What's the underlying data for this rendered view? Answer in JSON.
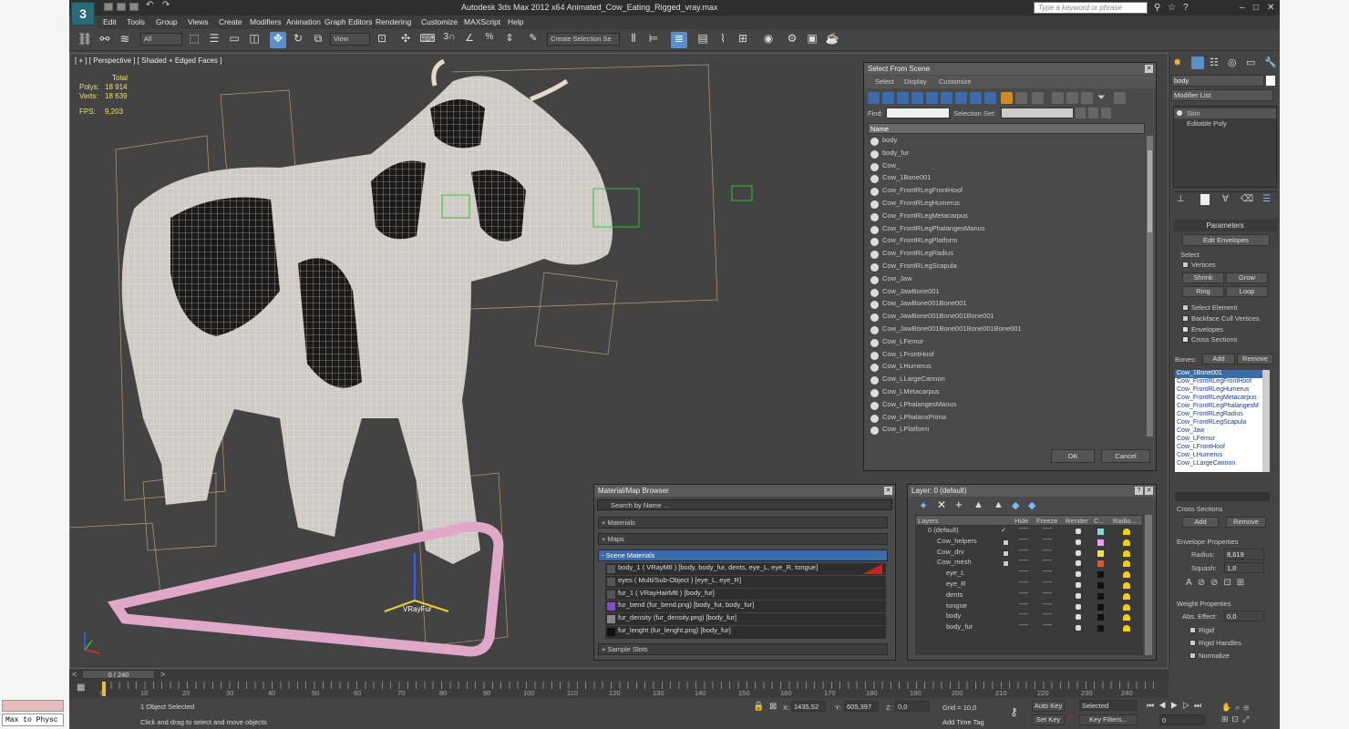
{
  "app": {
    "title": "Autodesk 3ds Max  2012 x64     Animated_Cow_Eating_Rigged_vray.max",
    "search_placeholder": "Type a keyword or phrase",
    "logo_text": "3"
  },
  "menu": [
    "Edit",
    "Tools",
    "Group",
    "Views",
    "Create",
    "Modifiers",
    "Animation",
    "Graph Editors",
    "Rendering",
    "Customize",
    "MAXScript",
    "Help"
  ],
  "toolbar": {
    "filter_value": "All",
    "view_value": "View",
    "selection_set_placeholder": "Create Selection Se"
  },
  "viewport": {
    "label": "[ + ] [ Perspective ] [ Shaded + Edged Faces ]",
    "stats": {
      "total_label": "Total",
      "polys_label": "Polys:",
      "polys_value": "18 914",
      "verts_label": "Verts:",
      "verts_value": "18 639",
      "fps_label": "FPS:",
      "fps_value": "9,203"
    },
    "gizmo_label": "VRayFur"
  },
  "select_from_scene": {
    "title": "Select From Scene",
    "menu": [
      "Select",
      "Display",
      "Customize"
    ],
    "find_label": "Find:",
    "selection_set_label": "Selection Set:",
    "column_name": "Name",
    "items": [
      "body",
      "body_fur",
      "Cow_",
      "Cow_1Bone001",
      "Cow_FrontRLegFrontHoof",
      "Cow_FrontRLegHumerus",
      "Cow_FrontRLegMetacarpus",
      "Cow_FrontRLegPhalangesManus",
      "Cow_FrontRLegPlatform",
      "Cow_FrontRLegRadius",
      "Cow_FrontRLegScapula",
      "Cow_Jaw",
      "Cow_JawBone001",
      "Cow_JawBone001Bone001",
      "Cow_JawBone001Bone001Bone001",
      "Cow_JawBone001Bone001Bone001Bone001",
      "Cow_LFemur",
      "Cow_LFrontHoof",
      "Cow_LHumerus",
      "Cow_LLargeCannon",
      "Cow_LMetacarpus",
      "Cow_LPhalangesManus",
      "Cow_LPhalanxPrima",
      "Cow_LPlatform"
    ],
    "ok_label": "OK",
    "cancel_label": "Cancel"
  },
  "material_browser": {
    "title": "Material/Map Browser",
    "search_placeholder": "Search by Name ...",
    "groups": [
      "+ Materials",
      "+ Maps",
      "- Scene Materials"
    ],
    "materials": [
      "body_1  ( VRayMtl ) [body, body_fur, dents, eye_L, eye_R, tongue]",
      "eyes  ( Multi/Sub-Object ) [eye_L, eye_R]",
      "fur_1  ( VRayHairMtl ) [body_fur]",
      "fur_bend (fur_bend.png) [body_fur, body_fur]",
      "fur_density (fur_density.png) [body_fur]",
      "fur_lenght (fur_lenght.png) [body_fur]"
    ],
    "sample_slots": "+ Sample Slots"
  },
  "layer_manager": {
    "title": "Layer: 0 (default)",
    "columns": [
      "Layers",
      "Hide",
      "Freeze",
      "Render",
      "C...",
      "Radio..."
    ],
    "layers": [
      {
        "name": "0 (default)",
        "indent": 0
      },
      {
        "name": "Cow_helpers",
        "indent": 0
      },
      {
        "name": "Cow_drv",
        "indent": 0
      },
      {
        "name": "Cow_mesh",
        "indent": 0
      },
      {
        "name": "eye_L",
        "indent": 1
      },
      {
        "name": "eye_R",
        "indent": 1
      },
      {
        "name": "dents",
        "indent": 1
      },
      {
        "name": "tongue",
        "indent": 1
      },
      {
        "name": "body",
        "indent": 1
      },
      {
        "name": "body_fur",
        "indent": 1
      }
    ],
    "hide_dots": "----"
  },
  "command_panel": {
    "object_name": "body",
    "modifier_list": "Modifier List",
    "stack": [
      "Skin",
      "Editable Poly"
    ],
    "parameters_title": "Parameters",
    "edit_envelopes": "Edit Envelopes",
    "select_label": "Select",
    "vertices": "Vertices",
    "shrink": "Shrink",
    "grow": "Grow",
    "ring": "Ring",
    "loop": "Loop",
    "select_element": "Select Element",
    "backface": "Backface Cull Vertices",
    "envelopes": "Envelopes",
    "cross_sections": "Cross Sections",
    "bones_label": "Bones:",
    "add": "Add",
    "remove": "Remove",
    "bones": [
      "Cow_1Bone001",
      "Cow_FrontRLegFrontHoof",
      "Cow_FrontRLegHumerus",
      "Cow_FrontRLegMetacarpus",
      "Cow_FrontRLegPhalangesM",
      "Cow_FrontRLegRadius",
      "Cow_FrontRLegScapula",
      "Cow_Jaw",
      "Cow_LFemur",
      "Cow_LFrontHoof",
      "Cow_LHumerus",
      "Cow_LLargeCannon"
    ],
    "cross_sections_title": "Cross Sections",
    "cs_add": "Add",
    "cs_remove": "Remove",
    "envelope_props": "Envelope Properties",
    "radius_label": "Radius:",
    "radius_value": "8,619",
    "squash_label": "Squash:",
    "squash_value": "1,0",
    "weight_props": "Weight Properties",
    "abs_effect_label": "Abs. Effect:",
    "abs_effect_value": "0,0",
    "rigid": "Rigid",
    "rigid_handles": "Rigid Handles",
    "normalize": "Normalize"
  },
  "timeline": {
    "frame": "0 / 240",
    "ticks": [
      "0",
      "10",
      "20",
      "30",
      "40",
      "50",
      "60",
      "70",
      "80",
      "90",
      "100",
      "110",
      "120",
      "130",
      "140",
      "150",
      "160",
      "170",
      "180",
      "190",
      "200",
      "210",
      "220",
      "230",
      "240"
    ]
  },
  "status": {
    "maxscript": "Max to Physc",
    "selected": "1 Object Selected",
    "prompt": "Click and drag to select and move objects",
    "x_label": "X:",
    "x_value": "1435,52",
    "y_label": "Y:",
    "y_value": "605,397",
    "z_label": "Z:",
    "z_value": "0,0",
    "grid": "Grid = 10,0",
    "add_time_tag": "Add Time Tag",
    "auto_key": "Auto Key",
    "set_key": "Set Key",
    "selected_dropdown": "Selected",
    "key_filters": "Key Filters...",
    "frame_value": "0"
  },
  "colors": {
    "accent": "#5a8fc8",
    "stats": "#f0e26a",
    "fur_ring": "#e0a8c8",
    "helper": "#2ec22e"
  }
}
